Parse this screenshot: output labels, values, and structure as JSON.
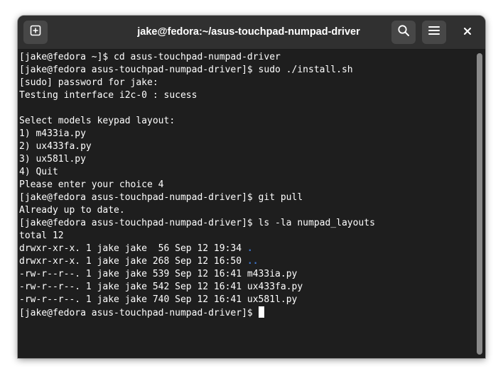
{
  "window": {
    "title": "jake@fedora:~/asus-touchpad-numpad-driver"
  },
  "headerbar": {
    "new_tab_icon": "new-tab-icon",
    "search_icon": "search-icon",
    "menu_icon": "hamburger-menu-icon",
    "close_label": "×"
  },
  "terminal": {
    "lines": [
      "[jake@fedora ~]$ cd asus-touchpad-numpad-driver",
      "[jake@fedora asus-touchpad-numpad-driver]$ sudo ./install.sh",
      "[sudo] password for jake:",
      "Testing interface i2c-0 : sucess",
      "",
      "Select models keypad layout:",
      "1) m433ia.py",
      "2) ux433fa.py",
      "3) ux581l.py",
      "4) Quit",
      "Please enter your choice 4",
      "[jake@fedora asus-touchpad-numpad-driver]$ git pull",
      "Already up to date.",
      "[jake@fedora asus-touchpad-numpad-driver]$ ls -la numpad_layouts",
      "total 12"
    ],
    "listing": [
      {
        "prefix": "drwxr-xr-x. 1 jake jake  56 Sep 12 19:34 ",
        "name": ".",
        "is_dir": true
      },
      {
        "prefix": "drwxr-xr-x. 1 jake jake 268 Sep 12 16:50 ",
        "name": "..",
        "is_dir": true
      },
      {
        "prefix": "-rw-r--r--. 1 jake jake 539 Sep 12 16:41 ",
        "name": "m433ia.py",
        "is_dir": false
      },
      {
        "prefix": "-rw-r--r--. 1 jake jake 542 Sep 12 16:41 ",
        "name": "ux433fa.py",
        "is_dir": false
      },
      {
        "prefix": "-rw-r--r--. 1 jake jake 740 Sep 12 16:41 ",
        "name": "ux581l.py",
        "is_dir": false
      }
    ],
    "prompt": "[jake@fedora asus-touchpad-numpad-driver]$ "
  },
  "colors": {
    "terminal_bg": "#1e1e1e",
    "headerbar_bg": "#303030",
    "button_bg": "#474747",
    "directory_text": "#3d73c8",
    "foreground": "#ffffff"
  }
}
